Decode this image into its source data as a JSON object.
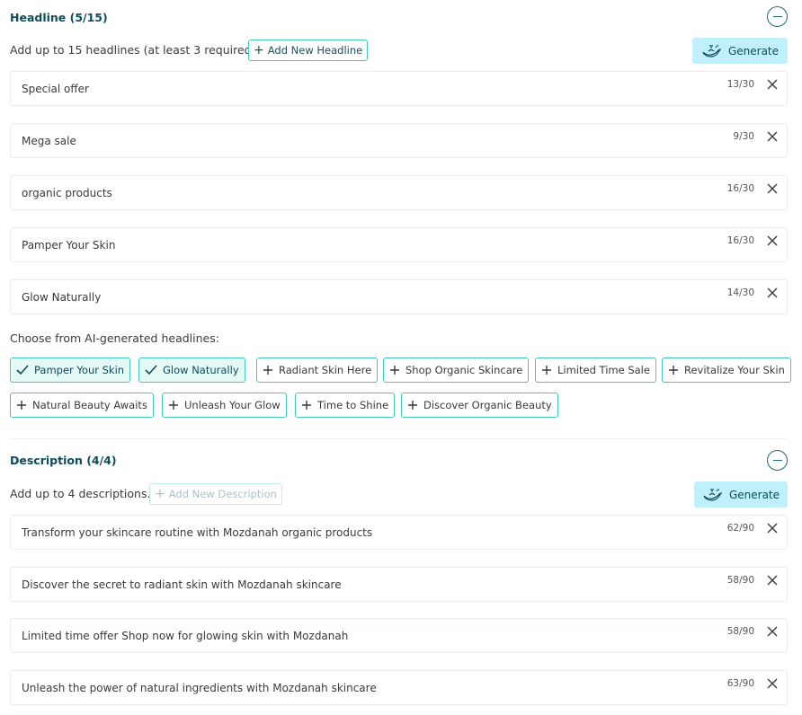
{
  "headline": {
    "title": "Headline (5/15)",
    "instructions": "Add up to 15 headlines (at least 3 required).",
    "add_label": "Add New Headline",
    "generate_label": "Generate",
    "items": [
      {
        "text": "Special offer",
        "count": "13/30"
      },
      {
        "text": "Mega sale",
        "count": "9/30"
      },
      {
        "text": "organic products",
        "count": "16/30"
      },
      {
        "text": "Pamper Your Skin",
        "count": "16/30"
      },
      {
        "text": "Glow Naturally",
        "count": "14/30"
      }
    ],
    "ai_label": "Choose from AI-generated headlines:",
    "suggestions": [
      {
        "text": "Pamper Your Skin",
        "selected": true
      },
      {
        "text": "Glow Naturally",
        "selected": true
      },
      {
        "text": "Radiant Skin Here",
        "selected": false
      },
      {
        "text": "Shop Organic Skincare",
        "selected": false
      },
      {
        "text": "Limited Time Sale",
        "selected": false
      },
      {
        "text": "Revitalize Your Skin",
        "selected": false
      },
      {
        "text": "Natural Beauty Awaits",
        "selected": false
      },
      {
        "text": "Unleash Your Glow",
        "selected": false
      },
      {
        "text": "Time to Shine",
        "selected": false
      },
      {
        "text": "Discover Organic Beauty",
        "selected": false
      }
    ]
  },
  "description": {
    "title": "Description (4/4)",
    "instructions": "Add up to 4 descriptions.",
    "add_label": "Add New Description",
    "generate_label": "Generate",
    "items": [
      {
        "text": "Transform your skincare routine with Mozdanah organic products",
        "count": "62/90"
      },
      {
        "text": "Discover the secret to radiant skin with Mozdanah skincare",
        "count": "58/90"
      },
      {
        "text": "Limited time offer Shop now for glowing skin with Mozdanah",
        "count": "58/90"
      },
      {
        "text": "Unleash the power of natural ingredients with Mozdanah skincare",
        "count": "63/90"
      }
    ]
  },
  "colors": {
    "accent": "#42c9b9",
    "title": "#0e4c5a",
    "generate_bg": "#bff0fb",
    "chip_selected_bg": "#e4f9f6"
  },
  "icons": {
    "collapse": "minus-circle-icon",
    "generate": "magic-lamp-icon",
    "remove": "close-icon",
    "add": "plus-icon",
    "selected": "check-icon"
  }
}
